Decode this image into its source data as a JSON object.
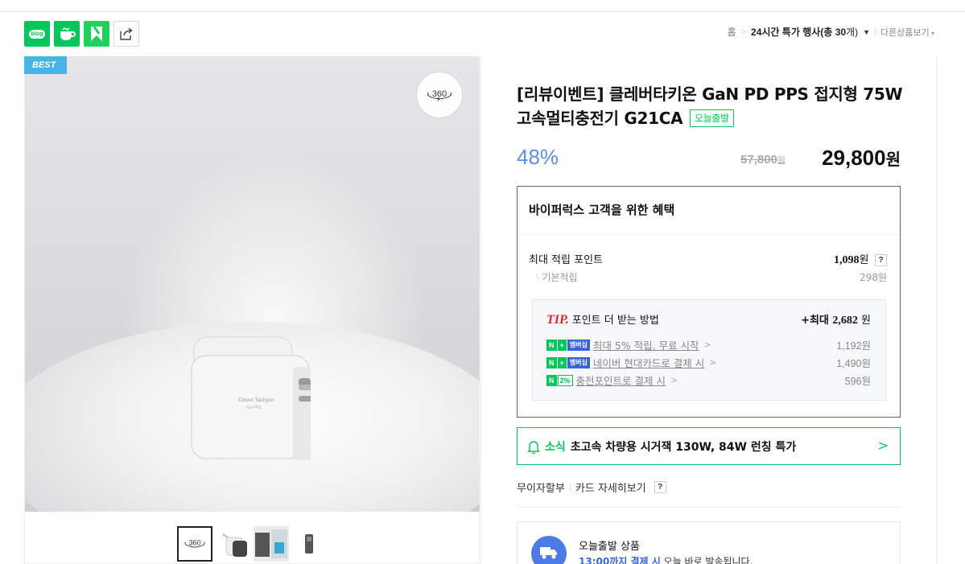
{
  "share": {
    "blog_label": "blog",
    "icons": [
      "blog-icon",
      "cafe-icon",
      "band-icon",
      "share-icon"
    ]
  },
  "breadcrumb": {
    "home": "홈",
    "category_prefix": "24시간 특가 행사(총 ",
    "category_count": "30",
    "category_suffix": "개)",
    "more": "다른상품보기"
  },
  "gallery": {
    "best_tag": "BEST",
    "view360": "360",
    "charger_brand": "Clever Tachyon",
    "charger_model": "Ga-PPS"
  },
  "product": {
    "title": "[리뷰이벤트] 클레버타키온 GaN PD PPS 접지형 75W 고속멀티충전기 G21CA",
    "badge": "오늘출발",
    "discount": "48%",
    "original_price": "57,800",
    "original_unit": "원",
    "sale_price": "29,800",
    "sale_unit": "원"
  },
  "benefit": {
    "heading": "바이퍼럭스 고객을 위한 혜택",
    "max_point_label": "최대 적립 포인트",
    "max_point_value": "1,098",
    "unit": "원",
    "help": "?",
    "basic_label": "기본적립",
    "basic_value": "298원",
    "tip_label": "TIP.",
    "tip_text": "포인트 더 받는 방법",
    "tip_max_prefix": "+최대 ",
    "tip_max_value": "2,682",
    "tip_max_unit": " 원",
    "tips": [
      {
        "badge_n": "N",
        "badge_plus": "+",
        "badge_extra": "멤버십",
        "text": "최대 5% 적립, 무료 시작",
        "amount": "1,192원"
      },
      {
        "badge_n": "N",
        "badge_plus": "+",
        "badge_extra": "멤버십",
        "text": "네이버 현대카드로 결제 시",
        "amount": "1,490원"
      },
      {
        "badge_n": "N",
        "badge_plus": "",
        "badge_extra": "2%",
        "text": "충전포인트로 결제 시",
        "amount": "596원"
      }
    ]
  },
  "news": {
    "tag": "소식",
    "message": "초고속 차량용 시거잭 130W, 84W 런칭 특가"
  },
  "card_links": {
    "installment": "무이자할부",
    "card_detail": "카드 자세히보기",
    "help": "?"
  },
  "shipping": {
    "title": "오늘출발 상품",
    "time": "13:00까지 결제 시",
    "desc": " 오늘 바로 발송됩니다."
  }
}
